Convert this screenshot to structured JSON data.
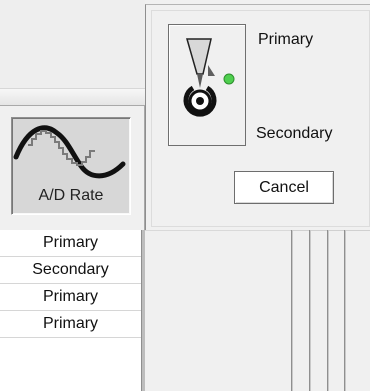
{
  "rate_button": {
    "label": "A/D Rate",
    "icon": "sine-wave-icon"
  },
  "switch_panel": {
    "icon": "toggle-switch-icon",
    "indicator_color": "#4fcf4f",
    "primary_label": "Primary",
    "secondary_label": "Secondary",
    "cancel_label": "Cancel"
  },
  "list": {
    "items": [
      "Primary",
      "Secondary",
      "Primary",
      "Primary"
    ]
  }
}
